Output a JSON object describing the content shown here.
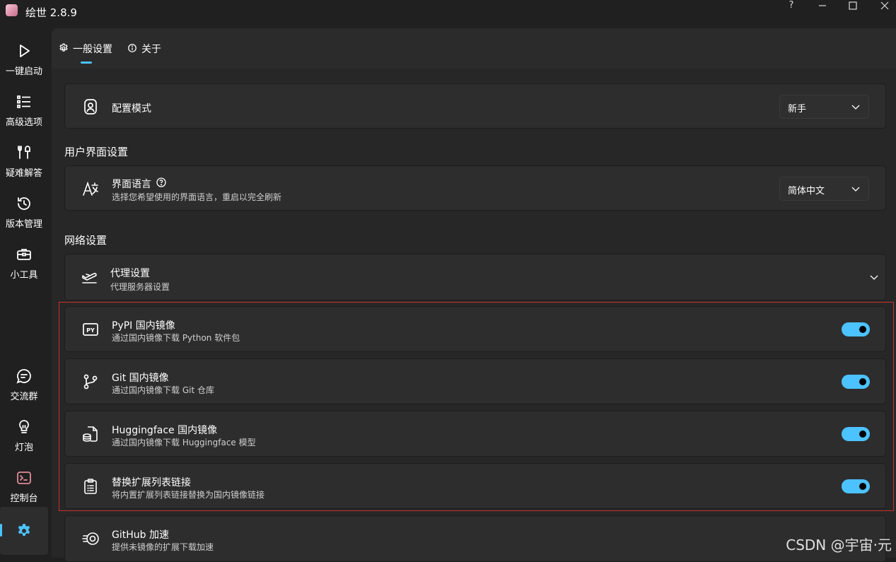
{
  "app": {
    "title": "绘世 2.8.9"
  },
  "window_controls": {
    "help": "?",
    "minimize": "—",
    "maximize": "□",
    "close": "✕"
  },
  "sidebar": {
    "items": [
      {
        "label": "一键启动",
        "icon": "play-icon"
      },
      {
        "label": "高级选项",
        "icon": "list-icon"
      },
      {
        "label": "疑难解答",
        "icon": "tools-icon"
      },
      {
        "label": "版本管理",
        "icon": "history-icon"
      },
      {
        "label": "小工具",
        "icon": "toolbox-icon"
      }
    ],
    "bottom_items": [
      {
        "label": "交流群",
        "icon": "chat-icon"
      },
      {
        "label": "灯泡",
        "icon": "lightbulb-icon"
      },
      {
        "label": "控制台",
        "icon": "console-icon"
      },
      {
        "label": "",
        "icon": "settings-icon",
        "active": true
      }
    ]
  },
  "tabs": [
    {
      "label": "一般设置",
      "icon": "gear-icon",
      "active": true
    },
    {
      "label": "关于",
      "icon": "info-icon"
    }
  ],
  "config_mode": {
    "title": "配置模式",
    "value": "新手"
  },
  "ui_section": {
    "title": "用户界面设置",
    "language": {
      "title": "界面语言",
      "help": "?",
      "subtitle": "选择您希望使用的界面语言，重启以完全刷新",
      "value": "简体中文"
    }
  },
  "network_section": {
    "title": "网络设置",
    "proxy": {
      "title": "代理设置",
      "subtitle": "代理服务器设置"
    },
    "mirrors": [
      {
        "title": "PyPI 国内镜像",
        "subtitle": "通过国内镜像下载 Python 软件包",
        "icon": "py-icon",
        "on": true
      },
      {
        "title": "Git 国内镜像",
        "subtitle": "通过国内镜像下载 Git 仓库",
        "icon": "git-branch-icon",
        "on": true
      },
      {
        "title": "Huggingface 国内镜像",
        "subtitle": "通过国内镜像下载 Huggingface 模型",
        "icon": "file-database-icon",
        "on": true
      },
      {
        "title": "替换扩展列表链接",
        "subtitle": "将内置扩展列表链接替换为国内镜像链接",
        "icon": "clipboard-list-icon",
        "on": true
      }
    ],
    "github": {
      "title": "GitHub 加速",
      "subtitle": "提供未镜像的扩展下载加速"
    }
  },
  "watermark": "CSDN @宇宙·元",
  "colors": {
    "accent": "#4cc2ff",
    "highlight_box": "#c9302c",
    "background": "#202020",
    "card": "#2d2d2d"
  }
}
